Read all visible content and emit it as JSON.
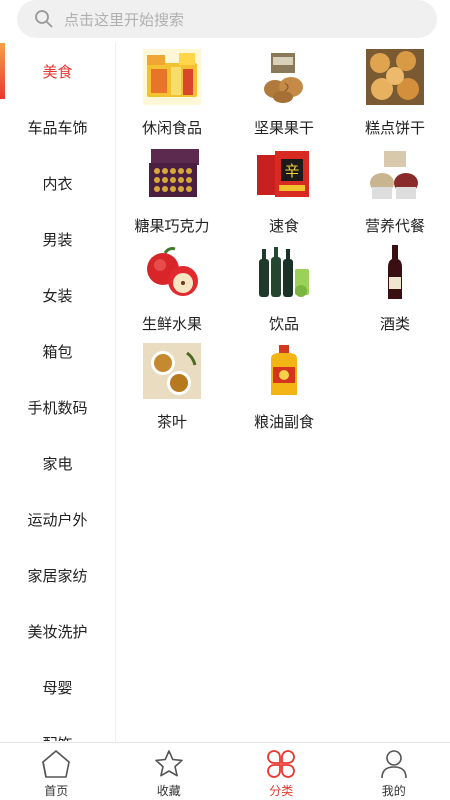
{
  "search": {
    "placeholder": "点击这里开始搜索"
  },
  "sidebar": {
    "items": [
      {
        "label": "美食",
        "active": true
      },
      {
        "label": "车品车饰"
      },
      {
        "label": "内衣"
      },
      {
        "label": "男装"
      },
      {
        "label": "女装"
      },
      {
        "label": "箱包"
      },
      {
        "label": "手机数码"
      },
      {
        "label": "家电"
      },
      {
        "label": "运动户外"
      },
      {
        "label": "家居家纺"
      },
      {
        "label": "美妆洗护"
      },
      {
        "label": "母婴"
      },
      {
        "label": "配饰"
      }
    ]
  },
  "grid": {
    "items": [
      {
        "label": "休闲食品",
        "icon": "snacks-icon"
      },
      {
        "label": "坚果果干",
        "icon": "nuts-icon"
      },
      {
        "label": "糕点饼干",
        "icon": "pastry-icon"
      },
      {
        "label": "糖果巧克力",
        "icon": "chocolate-icon"
      },
      {
        "label": "速食",
        "icon": "instant-noodle-icon"
      },
      {
        "label": "营养代餐",
        "icon": "grain-icon"
      },
      {
        "label": "生鲜水果",
        "icon": "apple-icon"
      },
      {
        "label": "饮品",
        "icon": "drink-bottle-icon"
      },
      {
        "label": "酒类",
        "icon": "wine-icon"
      },
      {
        "label": "茶叶",
        "icon": "tea-icon"
      },
      {
        "label": "粮油副食",
        "icon": "oil-icon"
      }
    ]
  },
  "tabbar": {
    "tabs": [
      {
        "label": "首页",
        "icon": "home-icon"
      },
      {
        "label": "收藏",
        "icon": "star-icon"
      },
      {
        "label": "分类",
        "icon": "category-icon",
        "active": true
      },
      {
        "label": "我的",
        "icon": "user-icon"
      }
    ]
  },
  "colors": {
    "accent": "#e8382f",
    "search_bg": "#f0f0f0"
  }
}
